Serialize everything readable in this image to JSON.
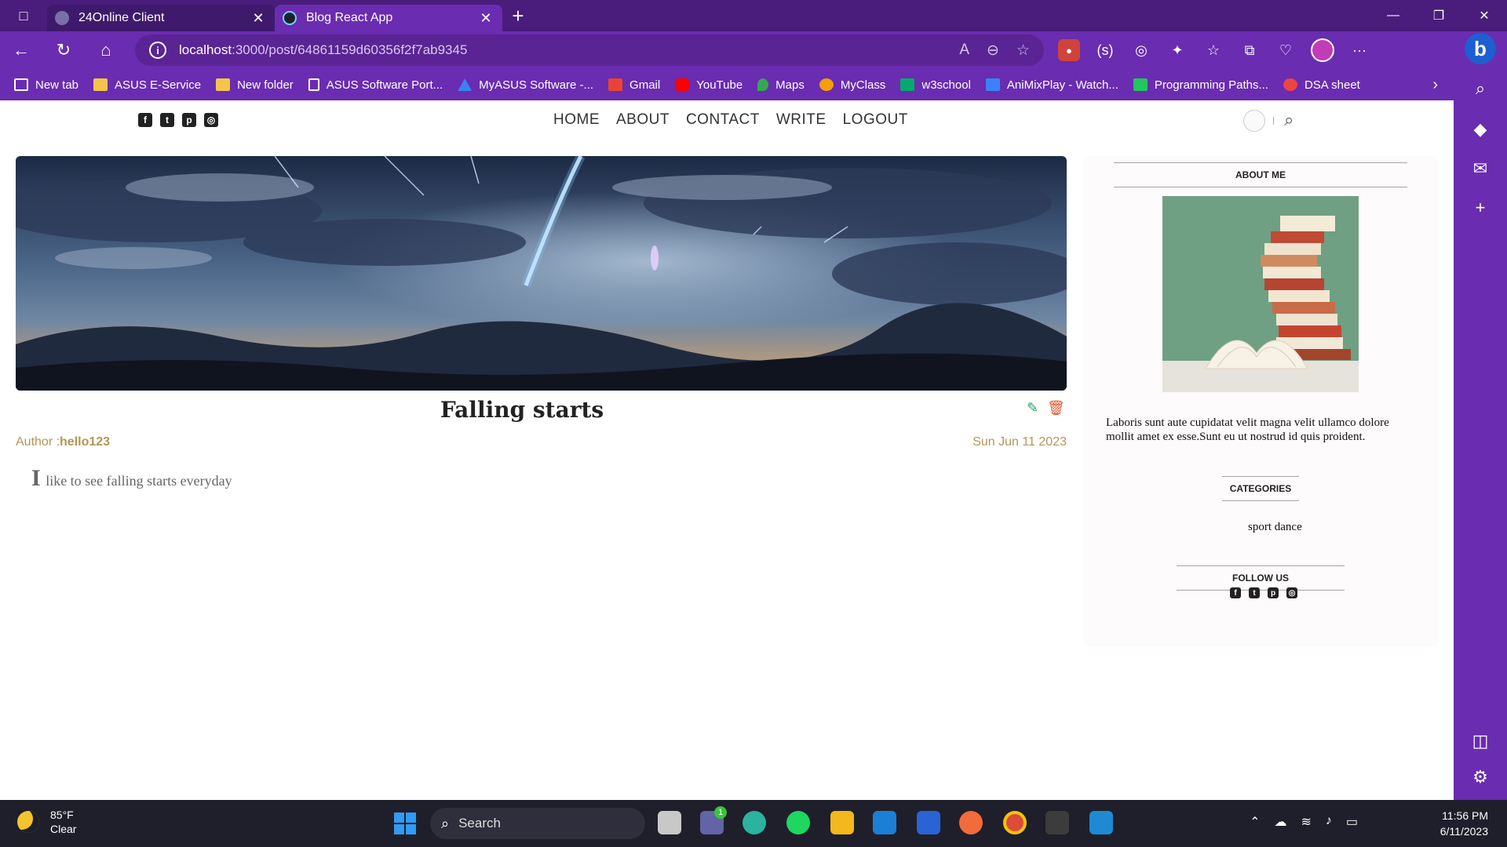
{
  "browser": {
    "tabs": [
      {
        "label": "24Online Client",
        "active": false,
        "icon": "cloud-icon"
      },
      {
        "label": "Blog React App",
        "active": true,
        "icon": "react-icon"
      }
    ],
    "url_host": "localhost",
    "url_path": ":3000/post/64861159d60356f2f7ab9345"
  },
  "bookmarks": [
    {
      "label": "New tab",
      "icon": "newtab-icon",
      "color": "#ffffff"
    },
    {
      "label": "ASUS E-Service",
      "icon": "folder-icon",
      "color": "#f3c54a"
    },
    {
      "label": "New folder",
      "icon": "folder-icon",
      "color": "#f3c54a"
    },
    {
      "label": "ASUS Software Port...",
      "icon": "page-icon",
      "color": "#ffffff"
    },
    {
      "label": "MyASUS Software -...",
      "icon": "myasus-icon",
      "color": "#3b82f6"
    },
    {
      "label": "Gmail",
      "icon": "gmail-icon",
      "color": "#ea4335"
    },
    {
      "label": "YouTube",
      "icon": "youtube-icon",
      "color": "#ff0000"
    },
    {
      "label": "Maps",
      "icon": "maps-icon",
      "color": "#34a853"
    },
    {
      "label": "MyClass",
      "icon": "myclass-icon",
      "color": "#f59e0b"
    },
    {
      "label": "w3school",
      "icon": "w3school-icon",
      "color": "#04aa6d"
    },
    {
      "label": "AniMixPlay - Watch...",
      "icon": "animix-icon",
      "color": "#3b82f6"
    },
    {
      "label": "Programming Paths...",
      "icon": "programming-icon",
      "color": "#22c55e"
    },
    {
      "label": "DSA sheet",
      "icon": "dsa-icon",
      "color": "#ef4444"
    }
  ],
  "site": {
    "menu": [
      "HOME",
      "ABOUT",
      "CONTACT",
      "WRITE",
      "LOGOUT"
    ],
    "post": {
      "title": "Falling starts",
      "author_label": "Author :",
      "author": "hello123",
      "date": "Sun Jun 11 2023",
      "desc_first": "I",
      "desc_rest": " like to see falling starts everyday"
    },
    "sidebar": {
      "about_title": "ABOUT ME",
      "about_text": "Laboris sunt aute cupidatat velit magna velit ullamco dolore mollit amet ex esse.Sunt eu ut nostrud id quis proident.",
      "categories_title": "CATEGORIES",
      "categories_text": "sport dance",
      "follow_title": "FOLLOW US"
    }
  },
  "taskbar": {
    "temp": "85°F",
    "condition": "Clear",
    "search_label": "Search",
    "time": "11:56 PM",
    "date": "6/11/2023",
    "badge": "1"
  }
}
